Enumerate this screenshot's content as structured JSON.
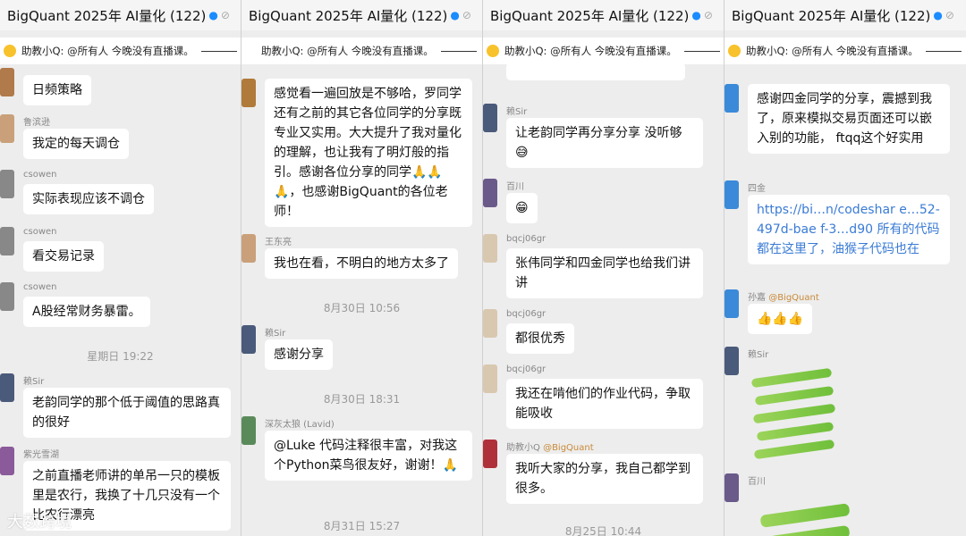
{
  "chat_title": "BigQuant 2025年 AI量化 (122)",
  "pinned": "助教小Q: @所有人   今晚没有直播课。",
  "watermark": "大数跨境",
  "panel1": {
    "m0": {
      "text": "日频策略"
    },
    "m1": {
      "sender": "鲁滨逊",
      "text": "我定的每天调仓"
    },
    "m2": {
      "sender": "csowen",
      "text": "实际表现应该不调仓"
    },
    "m3": {
      "sender": "csowen",
      "text": "看交易记录"
    },
    "m4": {
      "sender": "csowen",
      "text": "A股经常财务暴雷。"
    },
    "time1": "星期日 19:22",
    "m5": {
      "sender": "赖Sir",
      "text": "老韵同学的那个低于阈值的思路真的很好"
    },
    "m6": {
      "sender": "紫光雪湖",
      "text": "之前直播老师讲的单吊一只的模板里是农行，我换了十几只没有一个比农行漂亮"
    }
  },
  "panel2": {
    "m0": {
      "text": "感觉看一遍回放是不够哈，罗同学还有之前的其它各位同学的分享既专业又实用。大大提升了我对量化的理解，也让我有了明灯般的指引。感谢各位分享的同学🙏🙏🙏，也感谢BigQuant的各位老师！"
    },
    "m1": {
      "sender": "王东亮",
      "text": "我也在看，不明白的地方太多了"
    },
    "time1": "8月30日 10:56",
    "m2": {
      "sender": "赖Sir",
      "text": "感谢分享"
    },
    "time2": "8月30日 18:31",
    "m3": {
      "sender": "深灰太狼 (Lavid)",
      "text": "@Luke 代码注释很丰富，对我这个Python菜鸟很友好，谢谢！🙏"
    },
    "time3": "8月31日 15:27"
  },
  "panel3": {
    "m1": {
      "sender": "赖Sir",
      "text": "让老韵同学再分享分享 没听够😅"
    },
    "m2": {
      "sender": "百川",
      "text": "😁"
    },
    "m3": {
      "sender": "bqcj06gr",
      "text": "张伟同学和四金同学也给我们讲讲"
    },
    "m4": {
      "sender": "bqcj06gr",
      "text": "都很优秀"
    },
    "m5": {
      "sender": "bqcj06gr",
      "text": "我还在啃他们的作业代码，争取能吸收"
    },
    "m6": {
      "sender": "助教小Q",
      "at": "@BigQuant",
      "text": "我听大家的分享，我自己都学到很多。"
    },
    "time1": "8月25日 10:44"
  },
  "panel4": {
    "m0": {
      "text": "感谢四金同学的分享，震撼到我了，原来模拟交易页面还可以嵌入别的功能，  ftqq这个好实用"
    },
    "m1": {
      "sender": "四金",
      "text": "https://bi…n/codeshar e…52-497d-bae f-3…d90 所有的代码都在这里了，油猴子代码也在"
    },
    "m2": {
      "sender": "孙嘉",
      "at": "@BigQuant",
      "text": "👍👍👍"
    },
    "m3": {
      "sender": "赖Sir"
    },
    "m4": {
      "sender": "百川"
    }
  },
  "colors": {
    "bubble": "#ffffff",
    "background": "#ededed",
    "time": "#999999",
    "accent": "#1a8cff"
  }
}
